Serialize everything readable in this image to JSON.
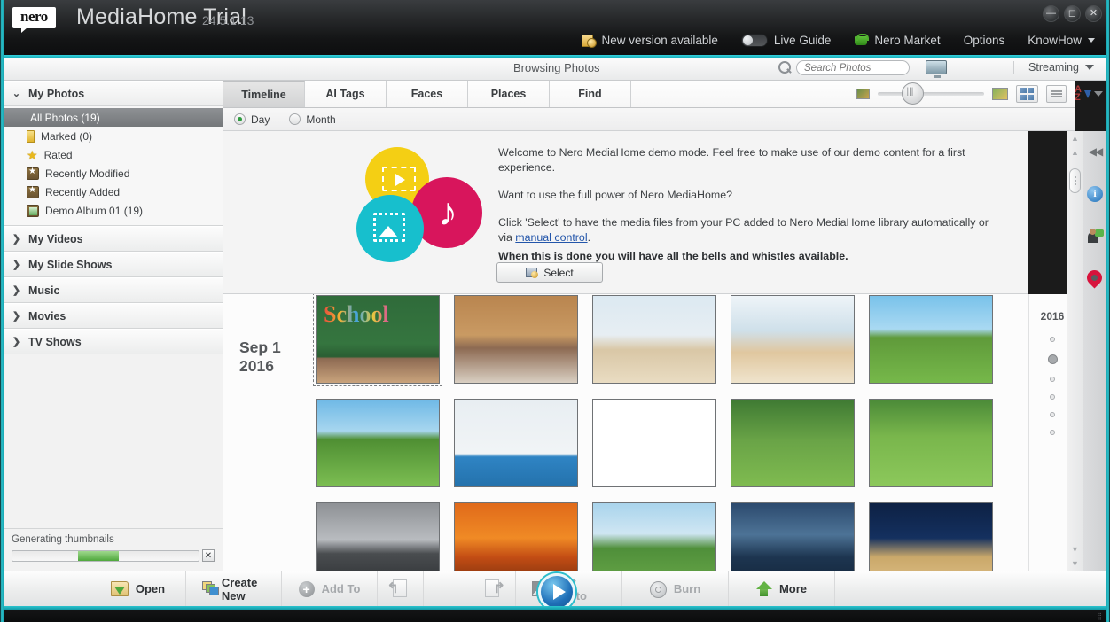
{
  "window": {
    "brand": "nero",
    "title": "MediaHome Trial",
    "version": "24.5.1.13",
    "minimize": "—",
    "maximize": "◻",
    "close": "✕"
  },
  "topbar": {
    "new_version": "New version available",
    "live_guide": "Live Guide",
    "nero_market": "Nero Market",
    "options": "Options",
    "knowhow": "KnowHow"
  },
  "header": {
    "browsing_title": "Browsing Photos",
    "search_placeholder": "Search Photos",
    "streaming": "Streaming"
  },
  "sidebar": {
    "groups": [
      {
        "label": "My Photos",
        "expanded": true,
        "chevron": "⌄",
        "items": [
          {
            "label": "All Photos (19)",
            "icon": "none",
            "selected": true
          },
          {
            "label": "Marked (0)",
            "icon": "marked-icon",
            "selected": false
          },
          {
            "label": "Rated",
            "icon": "star-icon",
            "selected": false
          },
          {
            "label": "Recently Modified",
            "icon": "folder-star-icon",
            "selected": false
          },
          {
            "label": "Recently Added",
            "icon": "folder-star-icon",
            "selected": false
          },
          {
            "label": "Demo Album 01 (19)",
            "icon": "album-icon",
            "selected": false
          }
        ]
      },
      {
        "label": "My Videos",
        "expanded": false,
        "chevron": "❯",
        "items": []
      },
      {
        "label": "My Slide Shows",
        "expanded": false,
        "chevron": "❯",
        "items": []
      },
      {
        "label": "Music",
        "expanded": false,
        "chevron": "❯",
        "items": []
      },
      {
        "label": "Movies",
        "expanded": false,
        "chevron": "❯",
        "items": []
      },
      {
        "label": "TV Shows",
        "expanded": false,
        "chevron": "❯",
        "items": []
      }
    ],
    "progress": {
      "label": "Generating thumbnails",
      "percent": 22,
      "cancel": "✕"
    }
  },
  "tabs": [
    {
      "label": "Timeline",
      "active": true
    },
    {
      "label": "AI Tags",
      "active": false
    },
    {
      "label": "Faces",
      "active": false
    },
    {
      "label": "Places",
      "active": false
    },
    {
      "label": "Find",
      "active": false
    }
  ],
  "viewmode": {
    "day": "Day",
    "month": "Month",
    "selected": "Day"
  },
  "welcome": {
    "line1": "Welcome to Nero MediaHome demo mode. Feel free to make use of our demo content for a first experience.",
    "line2": "Want to use the full power of Nero MediaHome?",
    "line3_a": "Click 'Select' to have the media files from your PC added to Nero MediaHome library automatically or via ",
    "line3_link": "manual control",
    "line3_b": ".",
    "line4": "When this is done you will have all the bells and whistles available.",
    "select_button": "Select"
  },
  "grid": {
    "date_line1": "Sep 1",
    "date_line2": "2016",
    "rows": [
      [
        {
          "name": "school-chalkboard-kids",
          "style": "p-school",
          "caption": "School",
          "selected": true
        },
        {
          "name": "kids-wooden-wall",
          "style": "p-wood",
          "caption": "",
          "selected": false
        },
        {
          "name": "kids-classroom-globe",
          "style": "p-class1",
          "caption": "",
          "selected": false
        },
        {
          "name": "kids-classroom-desk",
          "style": "p-class2",
          "caption": "",
          "selected": false
        },
        {
          "name": "kids-running-meadow",
          "style": "p-field1",
          "caption": "",
          "selected": false
        }
      ],
      [
        {
          "name": "kids-walking-field",
          "style": "p-field2",
          "caption": "",
          "selected": false
        },
        {
          "name": "karate-kids-blue-mat",
          "style": "p-karate1",
          "caption": "",
          "selected": false
        },
        {
          "name": "karate-kids-white-bg",
          "style": "p-karate2",
          "caption": "",
          "selected": false
        },
        {
          "name": "kids-soccer-goal",
          "style": "p-soccer1",
          "caption": "",
          "selected": false
        },
        {
          "name": "kids-with-ball",
          "style": "p-soccer2",
          "caption": "",
          "selected": false
        }
      ],
      [
        {
          "name": "mountain-bw",
          "style": "p-mtn",
          "caption": "",
          "selected": false
        },
        {
          "name": "desert-sunset",
          "style": "p-sunset",
          "caption": "",
          "selected": false
        },
        {
          "name": "giraffes",
          "style": "p-giraffe",
          "caption": "",
          "selected": false
        },
        {
          "name": "city-skyline-dusk",
          "style": "p-city",
          "caption": "",
          "selected": false
        },
        {
          "name": "brandenburg-gate-night",
          "style": "p-gate",
          "caption": "",
          "selected": false
        }
      ]
    ]
  },
  "timeline_rail": {
    "year": "2016",
    "dots": [
      {
        "active": false
      },
      {
        "active": true
      },
      {
        "active": false
      },
      {
        "active": false
      },
      {
        "active": false
      },
      {
        "active": false
      }
    ]
  },
  "bottombar": {
    "buttons": [
      {
        "label": "Open",
        "icon": "open-folder-icon",
        "disabled": false
      },
      {
        "label": "Create New",
        "icon": "create-new-icon",
        "disabled": false
      },
      {
        "label": "Add To",
        "icon": "plus-circle-icon",
        "disabled": true
      },
      {
        "label": "Edit Photo",
        "icon": "edit-photo-icon",
        "disabled": true
      },
      {
        "label": "Burn",
        "icon": "burn-disc-icon",
        "disabled": true
      },
      {
        "label": "More",
        "icon": "more-up-icon",
        "disabled": false
      }
    ],
    "play": "▶"
  },
  "dock": {
    "items": [
      {
        "name": "collapse-panel-icon",
        "glyph": "◀◀"
      },
      {
        "name": "info-icon",
        "glyph": "i"
      },
      {
        "name": "people-icon",
        "glyph": ""
      },
      {
        "name": "location-pin-icon",
        "glyph": ""
      }
    ]
  },
  "colors": {
    "teal": "#2bc4cf",
    "accent_blue": "#1f6fb8",
    "progress_green": "#4fa83c",
    "brand_yellow": "#f4cf14",
    "brand_pink": "#d8155c",
    "brand_cyan": "#17bfcd"
  }
}
